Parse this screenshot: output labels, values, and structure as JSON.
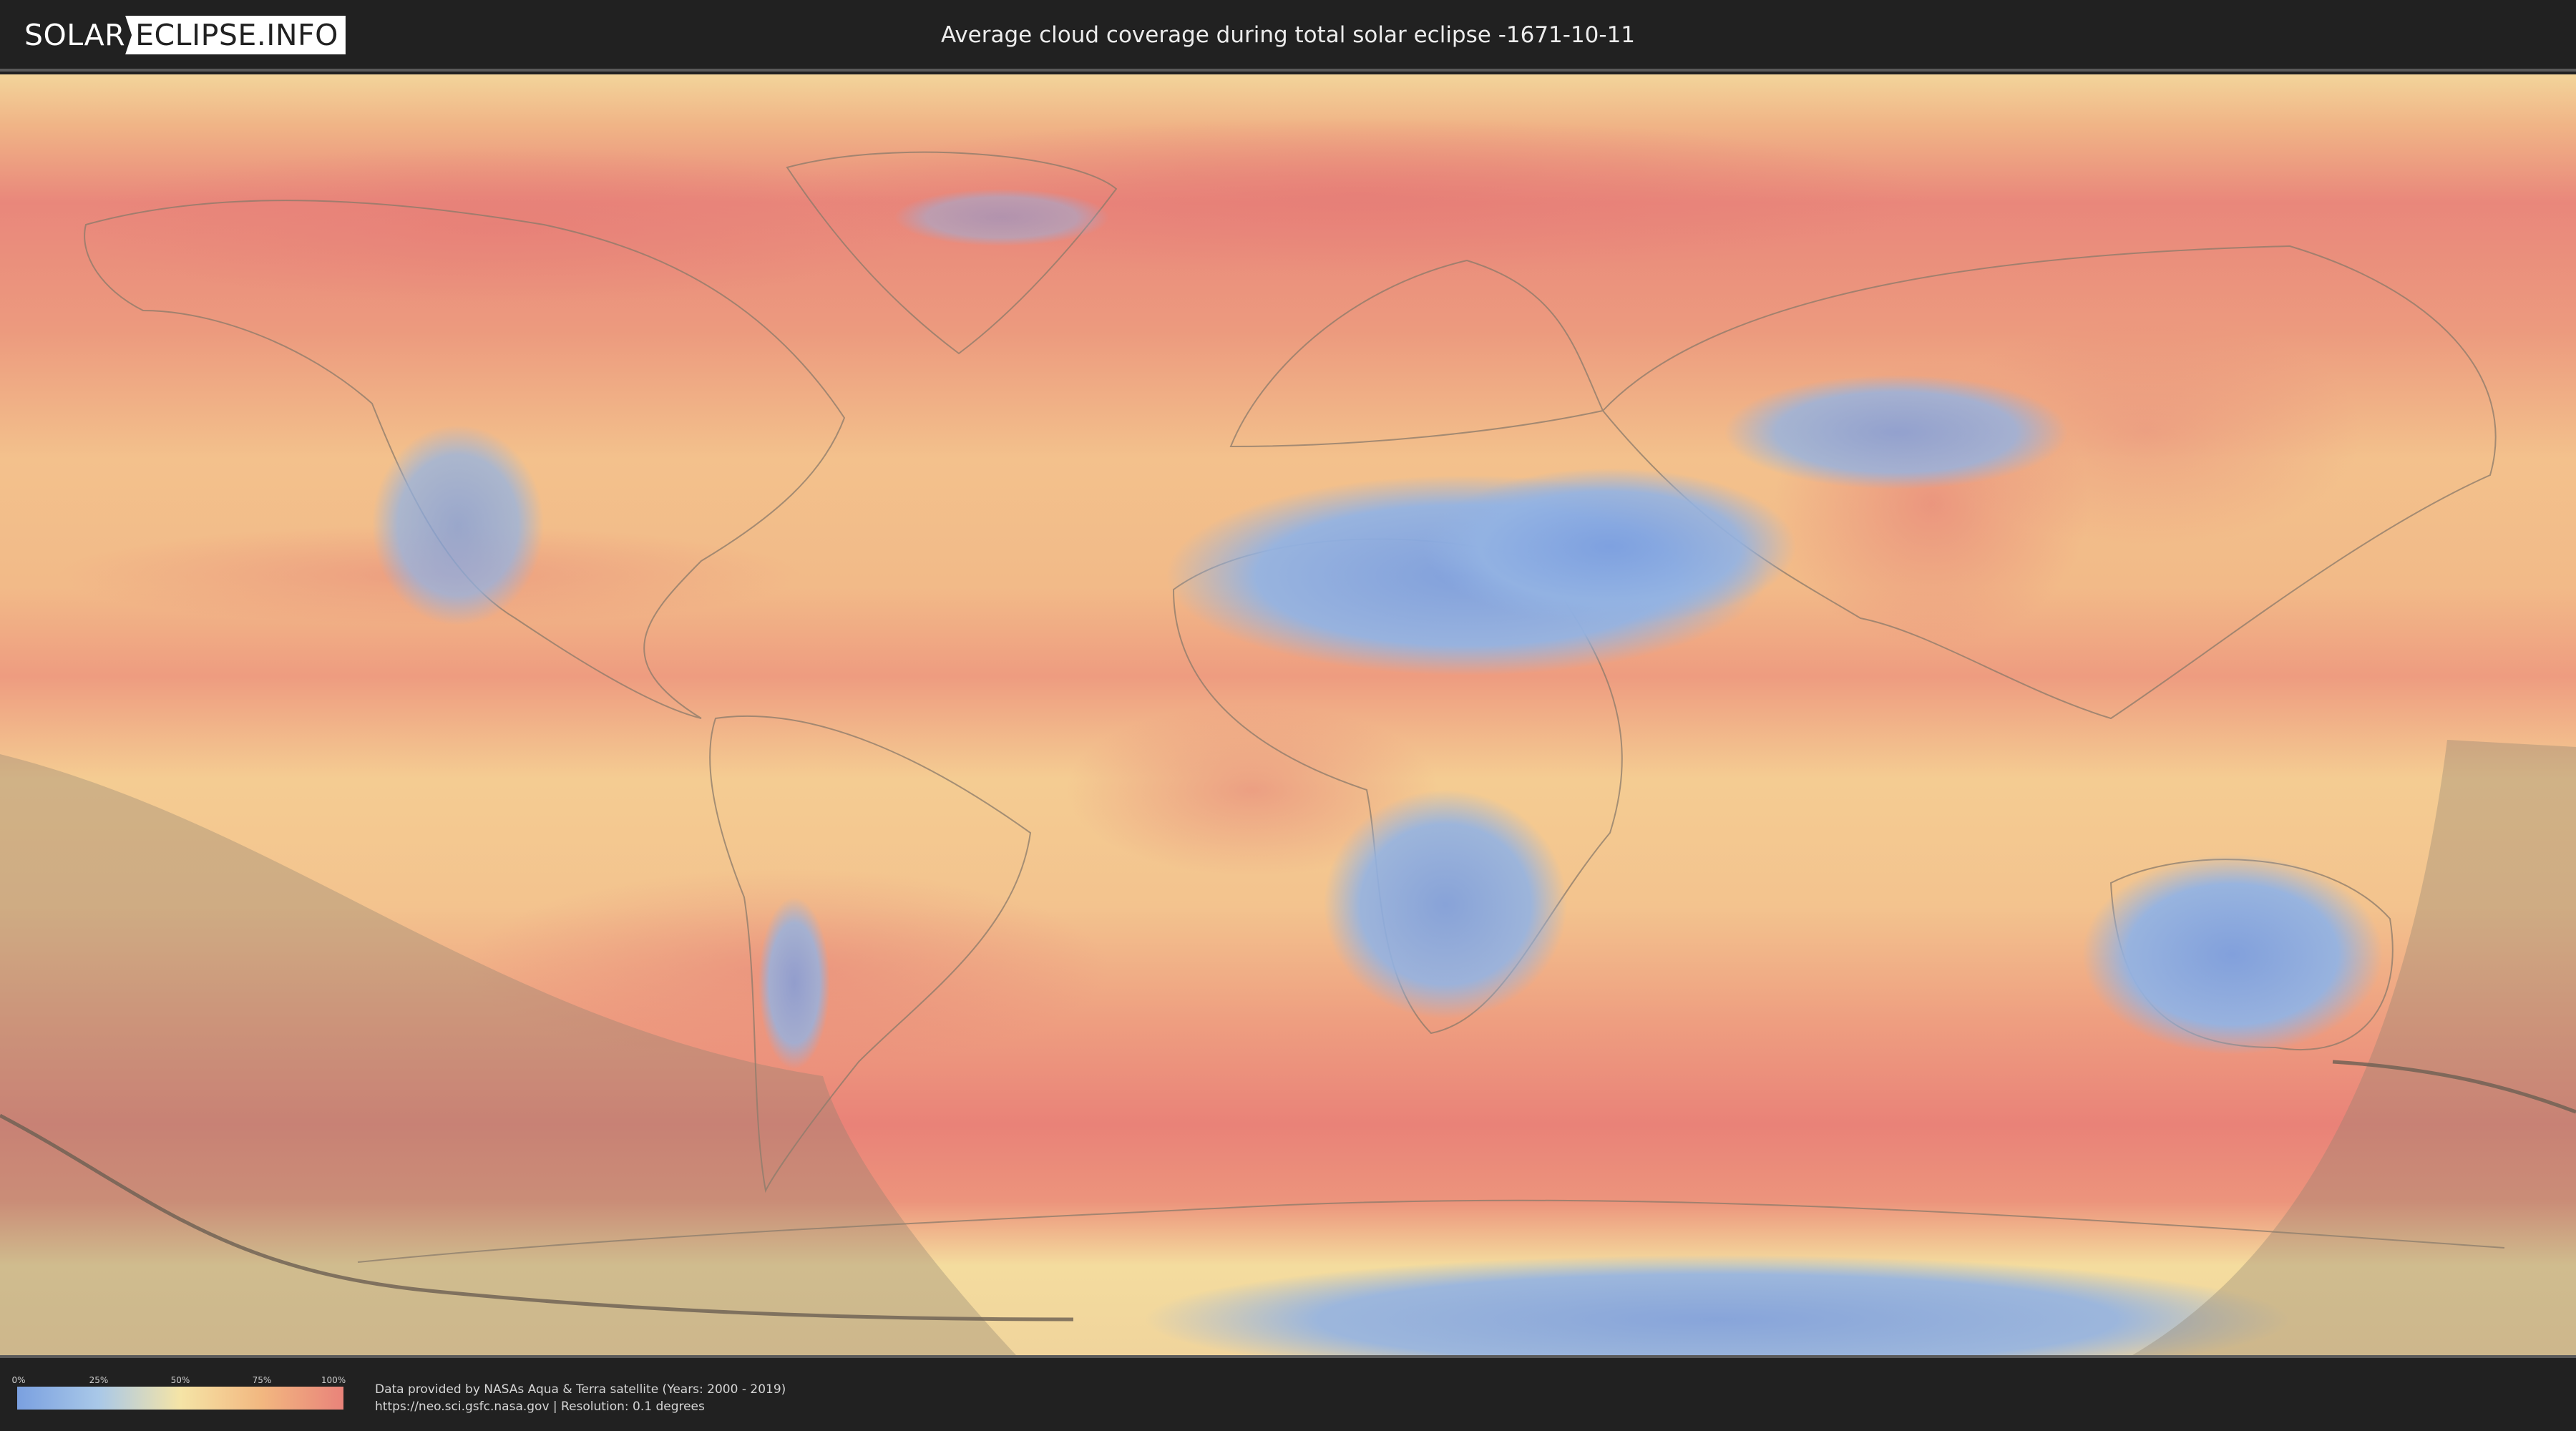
{
  "header": {
    "logo_part1": "SOLAR",
    "logo_part2": "ECLIPSE.INFO",
    "title": "Average cloud coverage during total solar eclipse -1671-10-11"
  },
  "map": {
    "description_icon": "world-cloud-coverage-map",
    "colors": {
      "ocean_cloudy": "#e9837a",
      "mid": "#f5e4a6",
      "clear": "#7aa0e0",
      "eclipse_shade": "#8c8070"
    }
  },
  "legend": {
    "ticks": [
      "0%",
      "25%",
      "50%",
      "75%",
      "100%"
    ],
    "gradient": [
      "#7aa0e0",
      "#a9c8e8",
      "#f5e4a6",
      "#f2b780",
      "#e9837a"
    ]
  },
  "attribution": {
    "line1": "Data provided by NASAs Aqua & Terra satellite (Years: 2000 - 2019)",
    "line2": "https://neo.sci.gsfc.nasa.gov | Resolution: 0.1 degrees"
  }
}
